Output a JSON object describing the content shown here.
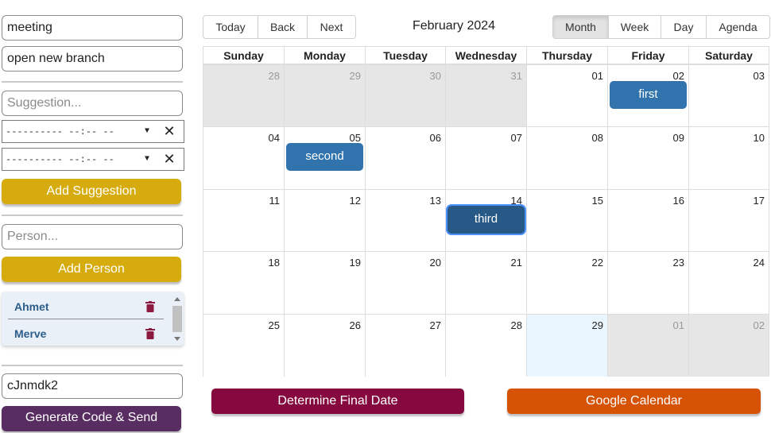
{
  "left_panel": {
    "title_input": "meeting",
    "description_input": "open new branch",
    "suggestion_placeholder": "Suggestion...",
    "datetime_rows": [
      {
        "placeholder": "---------- --:-- --"
      },
      {
        "placeholder": "---------- --:-- --"
      }
    ],
    "add_suggestion_label": "Add Suggestion",
    "person_placeholder": "Person...",
    "add_person_label": "Add Person",
    "people": [
      "Ahmet",
      "Merve"
    ],
    "code_input": "cJnmdk2",
    "generate_label": "Generate Code & Send"
  },
  "toolbar": {
    "nav": [
      "Today",
      "Back",
      "Next"
    ],
    "title": "February 2024",
    "views": [
      "Month",
      "Week",
      "Day",
      "Agenda"
    ],
    "active_view": "Month"
  },
  "calendar": {
    "weekdays": [
      "Sunday",
      "Monday",
      "Tuesday",
      "Wednesday",
      "Thursday",
      "Friday",
      "Saturday"
    ],
    "weeks": [
      [
        "28",
        "29",
        "30",
        "31",
        "01",
        "02",
        "03"
      ],
      [
        "04",
        "05",
        "06",
        "07",
        "08",
        "09",
        "10"
      ],
      [
        "11",
        "12",
        "13",
        "14",
        "15",
        "16",
        "17"
      ],
      [
        "18",
        "19",
        "20",
        "21",
        "22",
        "23",
        "24"
      ],
      [
        "25",
        "26",
        "27",
        "28",
        "29",
        "01",
        "02"
      ]
    ],
    "off_range": [
      [
        0,
        0
      ],
      [
        0,
        1
      ],
      [
        0,
        2
      ],
      [
        0,
        3
      ],
      [
        4,
        5
      ],
      [
        4,
        6
      ]
    ],
    "today": [
      4,
      4
    ],
    "events": [
      {
        "label": "first",
        "week": 0,
        "day": 5,
        "selected": false
      },
      {
        "label": "second",
        "week": 1,
        "day": 1,
        "selected": false
      },
      {
        "label": "third",
        "week": 2,
        "day": 3,
        "selected": true
      }
    ]
  },
  "actions": {
    "final_date_label": "Determine Final Date",
    "google_label": "Google Calendar"
  },
  "colors": {
    "yellow": "#d6ab0e",
    "purple": "#582d61",
    "event": "#3174ad",
    "event_selected": "#265985",
    "final_date": "#85093f",
    "google": "#d65306",
    "off_range": "#e6e6e6",
    "today": "#eaf6ff"
  }
}
